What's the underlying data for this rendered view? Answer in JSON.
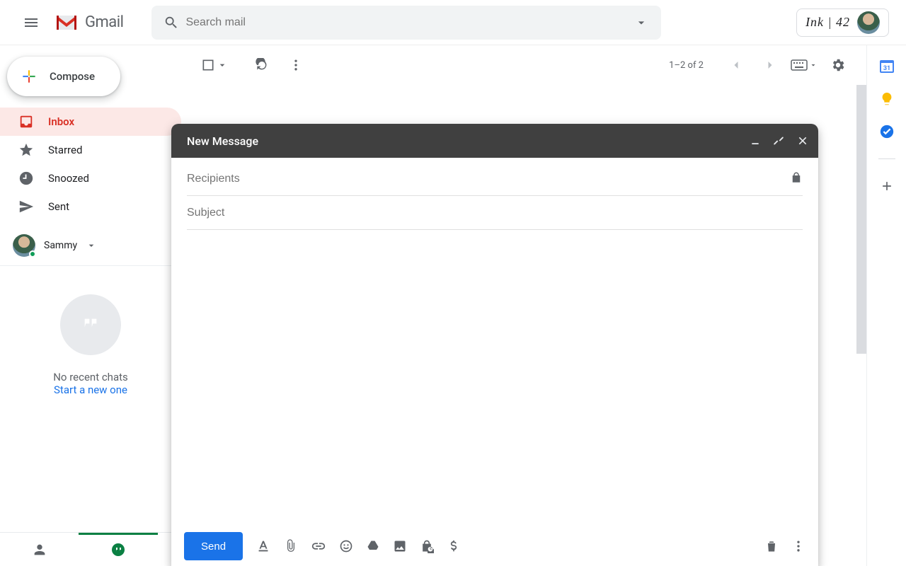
{
  "header": {
    "app_name": "Gmail",
    "search_placeholder": "Search mail",
    "brand_label": "Ink | 42"
  },
  "sidebar": {
    "compose_label": "Compose",
    "items": [
      {
        "label": "Inbox"
      },
      {
        "label": "Starred"
      },
      {
        "label": "Snoozed"
      },
      {
        "label": "Sent"
      }
    ],
    "hangouts_user": "Sammy",
    "hangouts_empty": "No recent chats",
    "hangouts_cta": "Start a new one"
  },
  "toolbar": {
    "count_label": "1–2 of 2"
  },
  "compose": {
    "title": "New Message",
    "recipients_placeholder": "Recipients",
    "subject_placeholder": "Subject",
    "send_label": "Send"
  },
  "right_panel": {
    "calendar_day": "31"
  }
}
